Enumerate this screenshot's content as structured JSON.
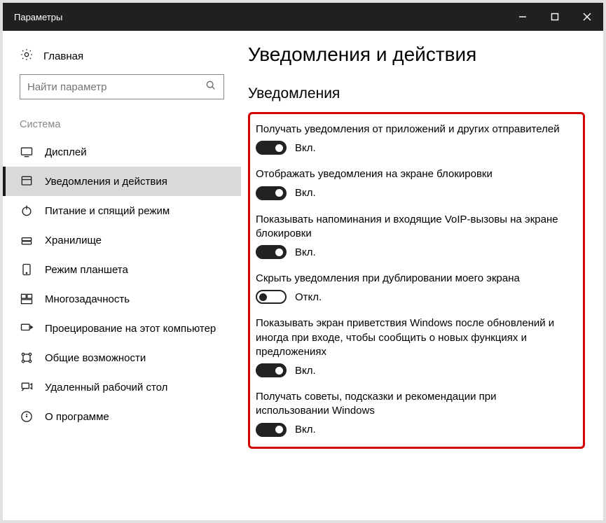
{
  "titlebar": {
    "title": "Параметры"
  },
  "sidebar": {
    "home": "Главная",
    "search_placeholder": "Найти параметр",
    "section": "Система",
    "items": [
      {
        "label": "Дисплей"
      },
      {
        "label": "Уведомления и действия"
      },
      {
        "label": "Питание и спящий режим"
      },
      {
        "label": "Хранилище"
      },
      {
        "label": "Режим планшета"
      },
      {
        "label": "Многозадачность"
      },
      {
        "label": "Проецирование на этот компьютер"
      },
      {
        "label": "Общие возможности"
      },
      {
        "label": "Удаленный рабочий стол"
      },
      {
        "label": "О программе"
      }
    ],
    "active_index": 1
  },
  "main": {
    "heading": "Уведомления и действия",
    "subheading": "Уведомления",
    "settings": [
      {
        "desc": "Получать уведомления от приложений и других отправителей",
        "on": true,
        "state_label": "Вкл."
      },
      {
        "desc": "Отображать уведомления на экране блокировки",
        "on": true,
        "state_label": "Вкл."
      },
      {
        "desc": "Показывать напоминания и входящие VoIP-вызовы на экране блокировки",
        "on": true,
        "state_label": "Вкл."
      },
      {
        "desc": "Скрыть уведомления при дублировании моего экрана",
        "on": false,
        "state_label": "Откл."
      },
      {
        "desc": "Показывать экран приветствия Windows после обновлений и иногда при входе, чтобы сообщить о новых функциях и предложениях",
        "on": true,
        "state_label": "Вкл."
      },
      {
        "desc": "Получать советы, подсказки и рекомендации при использовании Windows",
        "on": true,
        "state_label": "Вкл."
      }
    ]
  },
  "colors": {
    "highlight_border": "#d30000"
  }
}
